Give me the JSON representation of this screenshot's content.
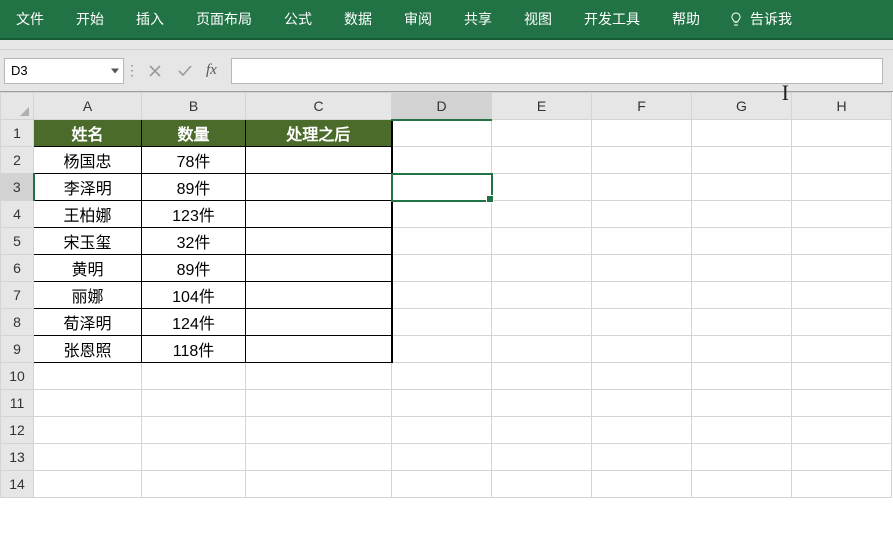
{
  "ribbon": {
    "items": [
      "文件",
      "开始",
      "插入",
      "页面布局",
      "公式",
      "数据",
      "审阅",
      "共享",
      "视图",
      "开发工具",
      "帮助"
    ],
    "tell_me": "告诉我"
  },
  "formula_bar": {
    "name_box": "D3",
    "fx": "fx",
    "input": ""
  },
  "columns": [
    "A",
    "B",
    "C",
    "D",
    "E",
    "F",
    "G",
    "H"
  ],
  "active": {
    "row": 3,
    "col": "D"
  },
  "table": {
    "headers": {
      "A": "姓名",
      "B": "数量",
      "C": "处理之后"
    },
    "rows": [
      {
        "A": "杨国忠",
        "B": "78件"
      },
      {
        "A": "李泽明",
        "B": "89件"
      },
      {
        "A": "王柏娜",
        "B": "123件"
      },
      {
        "A": "宋玉玺",
        "B": "32件"
      },
      {
        "A": "黄明",
        "B": "89件"
      },
      {
        "A": "丽娜",
        "B": "104件"
      },
      {
        "A": "荀泽明",
        "B": "124件"
      },
      {
        "A": "张恩照",
        "B": "118件"
      }
    ]
  },
  "visible_rows": 14,
  "chart_data": {
    "type": "table",
    "columns": [
      "姓名",
      "数量",
      "处理之后"
    ],
    "rows": [
      [
        "杨国忠",
        "78件",
        ""
      ],
      [
        "李泽明",
        "89件",
        ""
      ],
      [
        "王柏娜",
        "123件",
        ""
      ],
      [
        "宋玉玺",
        "32件",
        ""
      ],
      [
        "黄明",
        "89件",
        ""
      ],
      [
        "丽娜",
        "104件",
        ""
      ],
      [
        "荀泽明",
        "124件",
        ""
      ],
      [
        "张恩照",
        "118件",
        ""
      ]
    ]
  }
}
